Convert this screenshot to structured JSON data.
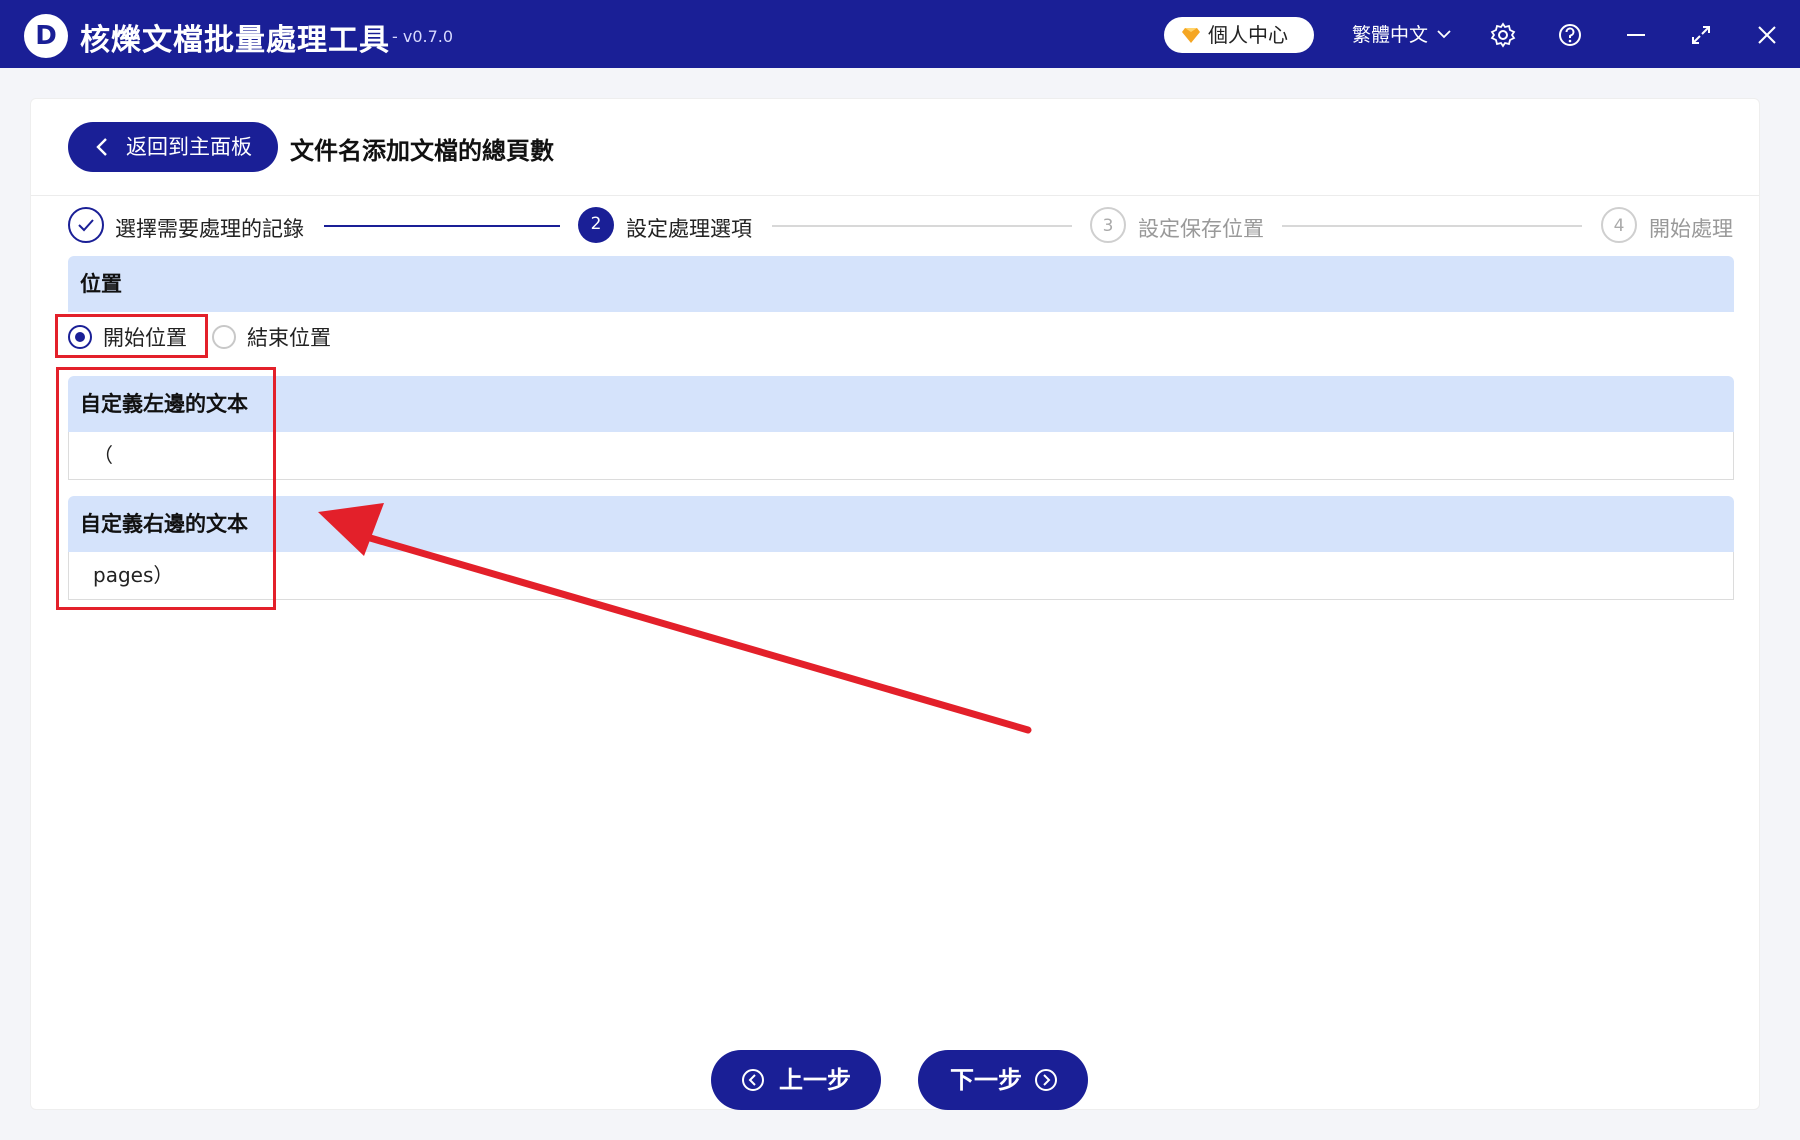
{
  "titlebar": {
    "logo_letter": "D",
    "app_name": "核爍文檔批量處理工具",
    "version": "- v0.7.0",
    "user_center": "個人中心",
    "language": "繁體中文"
  },
  "header": {
    "back_label": "返回到主面板",
    "page_title": "文件名添加文檔的總頁數"
  },
  "steps": [
    {
      "number": "",
      "label": "選擇需要處理的記錄",
      "state": "done"
    },
    {
      "number": "2",
      "label": "設定處理選項",
      "state": "active"
    },
    {
      "number": "3",
      "label": "設定保存位置",
      "state": "pending"
    },
    {
      "number": "4",
      "label": "開始處理",
      "state": "pending"
    }
  ],
  "position": {
    "header": "位置",
    "options": [
      {
        "label": "開始位置",
        "selected": true
      },
      {
        "label": "結束位置",
        "selected": false
      }
    ]
  },
  "left_text": {
    "header": "自定義左邊的文本",
    "value": "（"
  },
  "right_text": {
    "header": "自定義右邊的文本",
    "value": "pages）"
  },
  "footer": {
    "prev_label": "上一步",
    "next_label": "下一步"
  },
  "colors": {
    "primary": "#1a1f96",
    "section_bg": "#d5e3fb",
    "highlight": "#e3202a"
  }
}
